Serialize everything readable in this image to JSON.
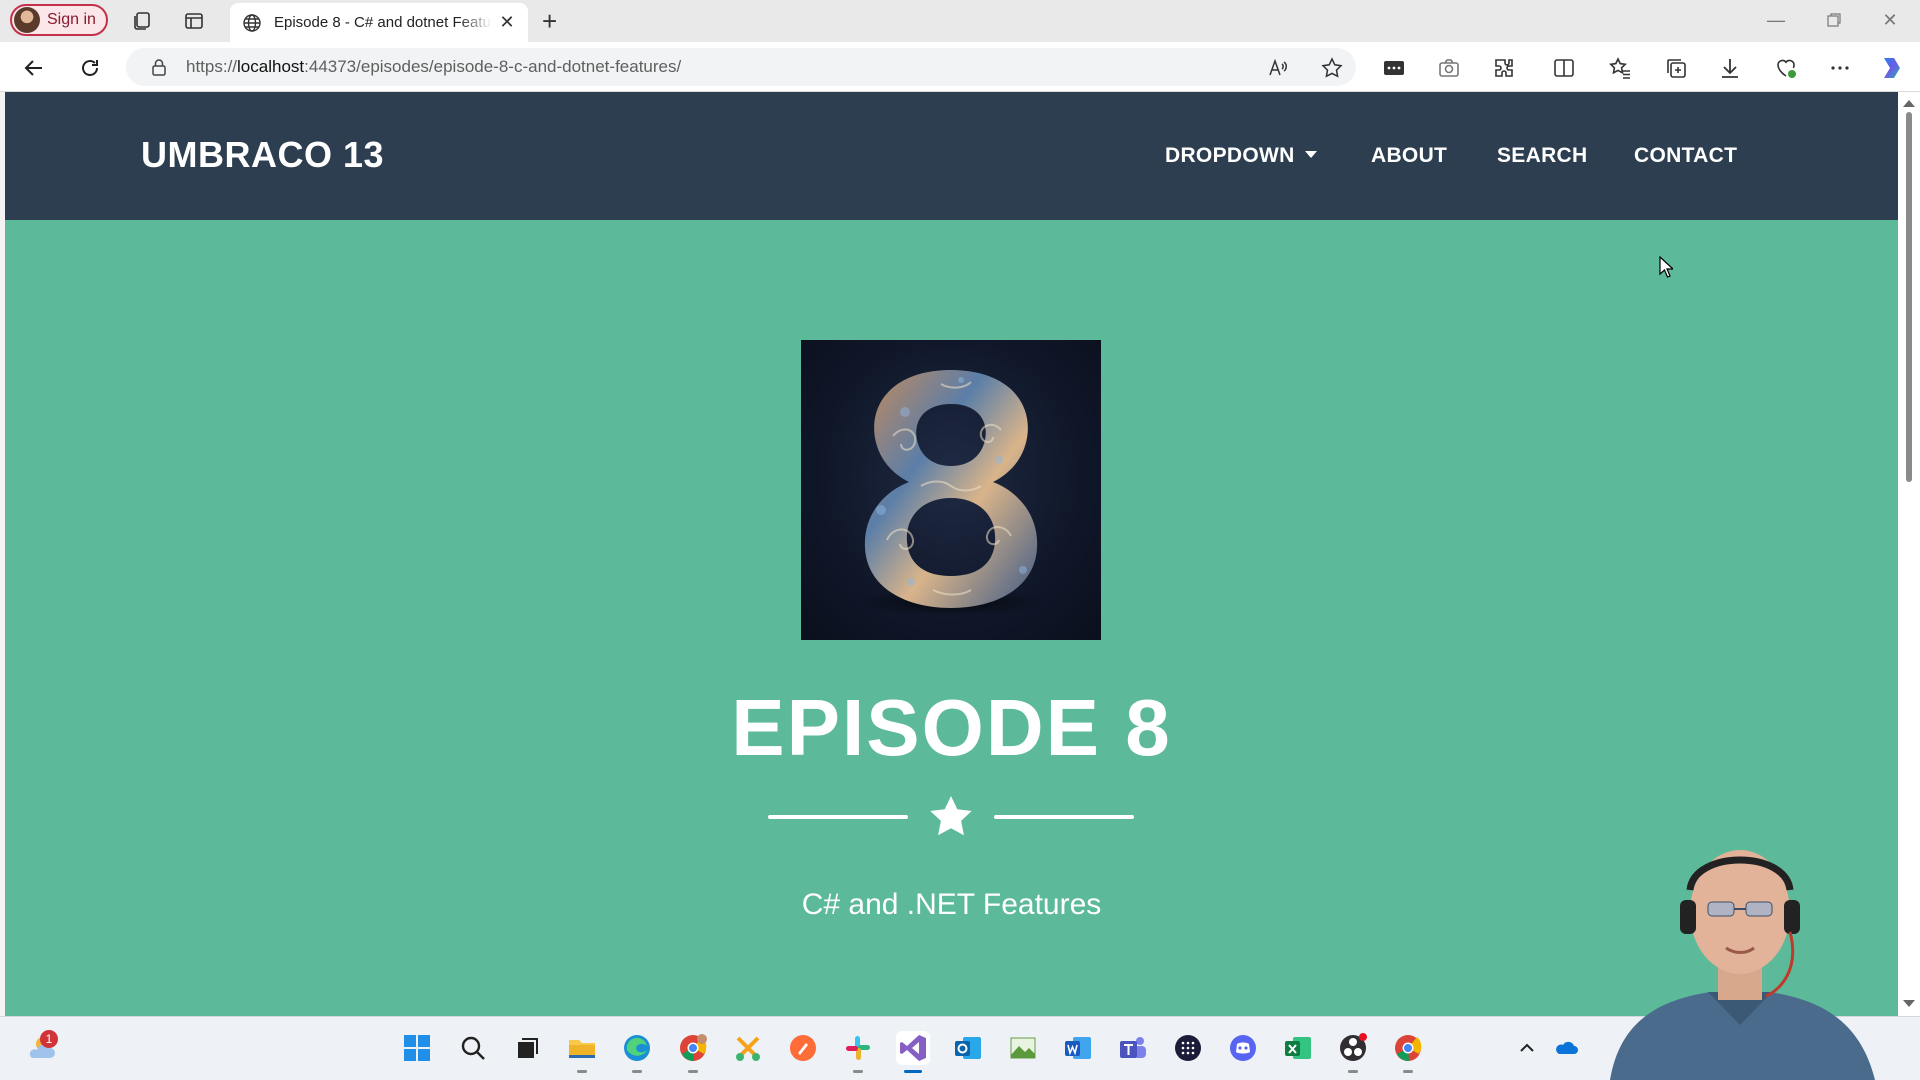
{
  "browser": {
    "signin_label": "Sign in",
    "tab_title": "Episode 8 - C# and dotnet Features",
    "url_prefix": "https://",
    "url_host": "localhost",
    "url_rest": ":44373/episodes/episode-8-c-and-dotnet-features/"
  },
  "site": {
    "brand": "UMBRACO 13",
    "nav": {
      "dropdown": "DROPDOWN",
      "about": "ABOUT",
      "search": "SEARCH",
      "contact": "CONTACT"
    }
  },
  "hero": {
    "title": "EPISODE 8",
    "subtitle": "C# and .NET Features",
    "image_icon": "number-eight-artwork"
  },
  "taskbar": {
    "weather_badge": "1"
  },
  "colors": {
    "nav_bg": "#2d3e50",
    "hero_bg": "#5cba9b",
    "text": "#ffffff"
  }
}
